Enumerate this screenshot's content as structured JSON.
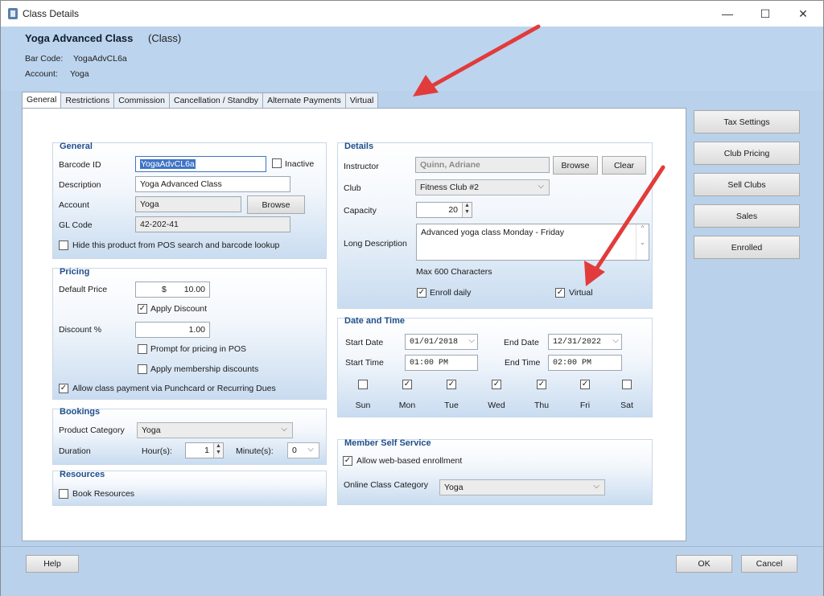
{
  "window": {
    "title": "Class Details",
    "minimize": "—",
    "maximize": "☐",
    "close": "✕"
  },
  "header": {
    "title": "Yoga Advanced Class",
    "type": "(Class)",
    "barcode_label": "Bar Code:",
    "barcode_value": "YogaAdvCL6a",
    "account_label": "Account:",
    "account_value": "Yoga"
  },
  "tabs": [
    "General",
    "Restrictions",
    "Commission",
    "Cancellation / Standby",
    "Alternate Payments",
    "Virtual"
  ],
  "general": {
    "title": "General",
    "barcode_label": "Barcode ID",
    "barcode_value": "YogaAdvCL6a",
    "inactive_label": "Inactive",
    "description_label": "Description",
    "description_value": "Yoga Advanced Class",
    "account_label": "Account",
    "account_value": "Yoga",
    "browse": "Browse",
    "glcode_label": "GL Code",
    "glcode_value": "42-202-41",
    "hide_label": "Hide this product from POS search and barcode lookup"
  },
  "pricing": {
    "title": "Pricing",
    "default_price_label": "Default Price",
    "currency": "$",
    "default_price_value": "10.00",
    "apply_discount_label": "Apply Discount",
    "discount_label": "Discount %",
    "discount_value": "1.00",
    "prompt_label": "Prompt for pricing in POS",
    "membership_label": "Apply membership discounts",
    "punchcard_label": "Allow class payment via Punchcard or Recurring Dues"
  },
  "bookings": {
    "title": "Bookings",
    "category_label": "Product Category",
    "category_value": "Yoga",
    "duration_label": "Duration",
    "hours_label": "Hour(s):",
    "hours_value": "1",
    "minutes_label": "Minute(s):",
    "minutes_value": "0"
  },
  "resources": {
    "title": "Resources",
    "book_label": "Book Resources"
  },
  "details": {
    "title": "Details",
    "instructor_label": "Instructor",
    "instructor_value": "Quinn, Adriane",
    "browse": "Browse",
    "clear": "Clear",
    "club_label": "Club",
    "club_value": "Fitness Club #2",
    "capacity_label": "Capacity",
    "capacity_value": "20",
    "long_desc_label": "Long Description",
    "long_desc_value": "Advanced yoga class Monday - Friday",
    "max_chars": "Max 600 Characters",
    "enroll_daily_label": "Enroll daily",
    "virtual_label": "Virtual"
  },
  "date_time": {
    "title": "Date and Time",
    "start_date_label": "Start Date",
    "start_date_value": "01/01/2018",
    "end_date_label": "End Date",
    "end_date_value": "12/31/2022",
    "start_time_label": "Start Time",
    "start_time_value": "01:00 PM",
    "end_time_label": "End Time",
    "end_time_value": "02:00 PM",
    "days": [
      {
        "label": "Sun",
        "checked": false
      },
      {
        "label": "Mon",
        "checked": true
      },
      {
        "label": "Tue",
        "checked": true
      },
      {
        "label": "Wed",
        "checked": true
      },
      {
        "label": "Thu",
        "checked": true
      },
      {
        "label": "Fri",
        "checked": true
      },
      {
        "label": "Sat",
        "checked": false
      }
    ]
  },
  "self_service": {
    "title": "Member Self Service",
    "web_enroll_label": "Allow web-based enrollment",
    "category_label": "Online Class Category",
    "category_value": "Yoga"
  },
  "side_buttons": [
    "Tax Settings",
    "Club Pricing",
    "Sell Clubs",
    "Sales",
    "Enrolled"
  ],
  "footer": {
    "help": "Help",
    "ok": "OK",
    "cancel": "Cancel"
  },
  "colors": {
    "accent": "#1f4e8c",
    "background": "#b9d1ea",
    "annotation_arrow": "#e23b3b"
  }
}
